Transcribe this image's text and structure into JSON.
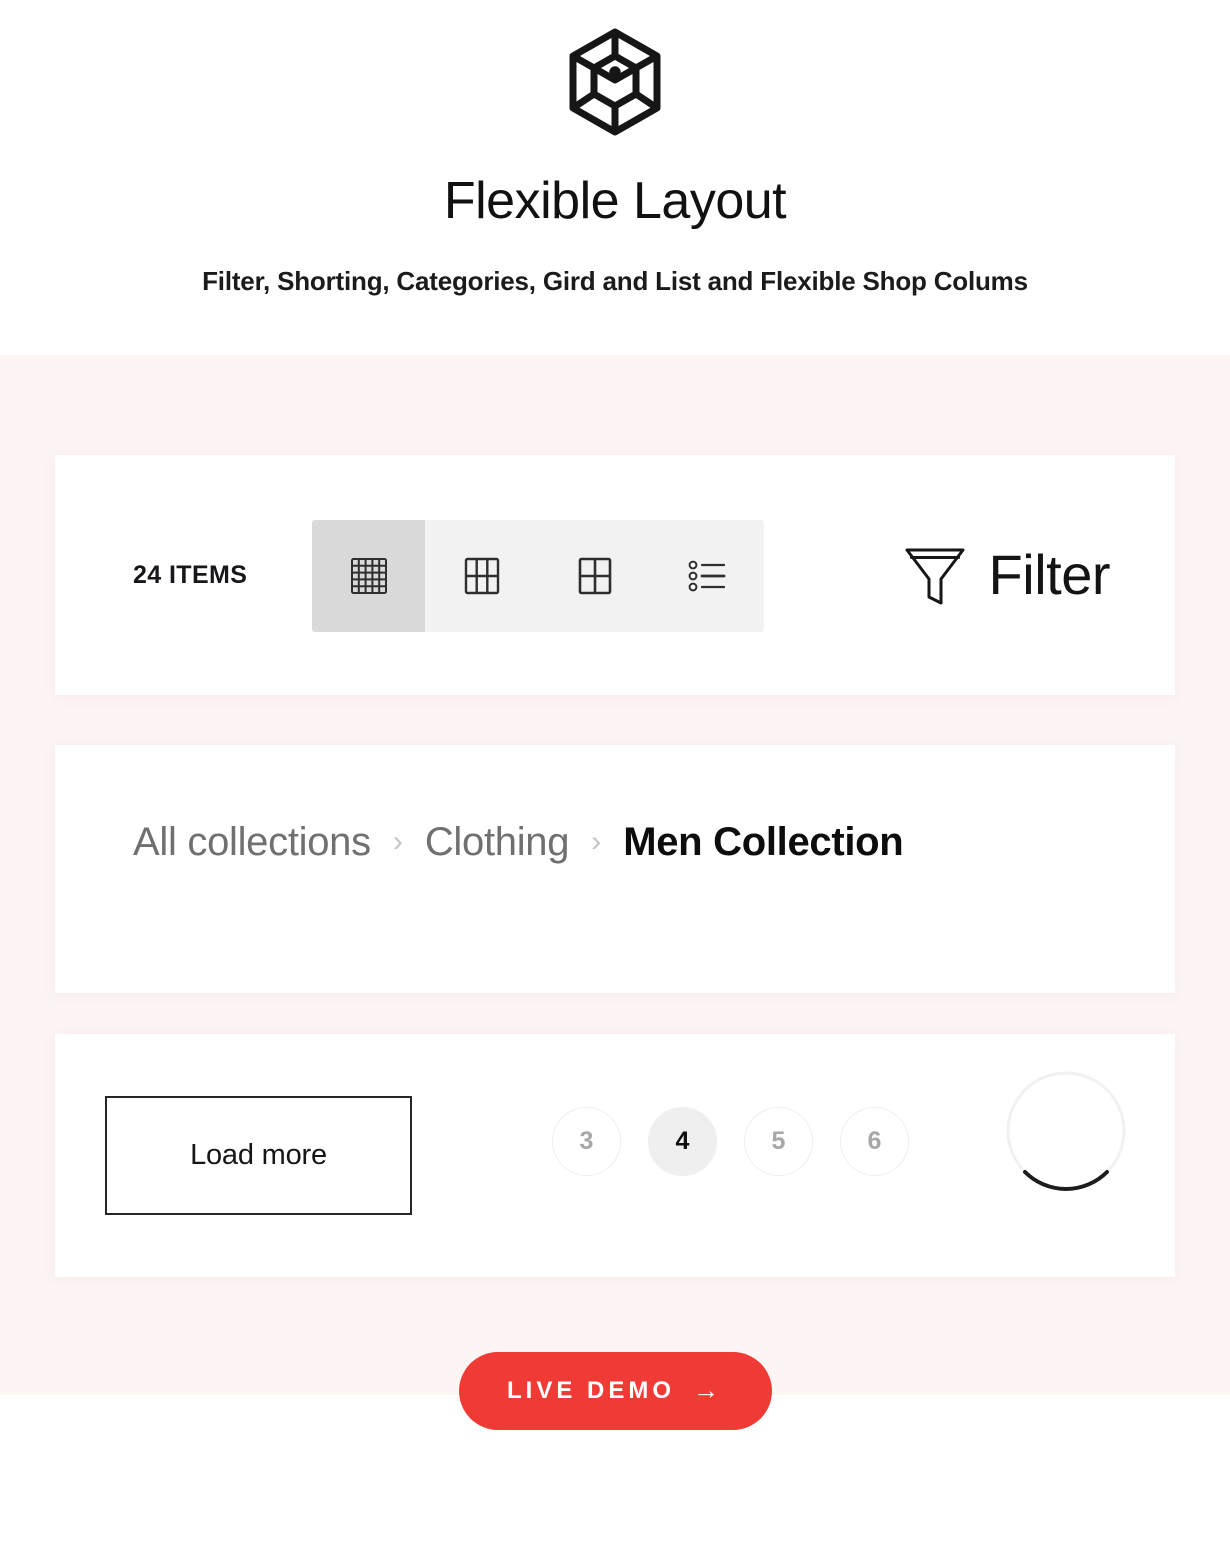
{
  "hero": {
    "logo_icon": "cube-logo-icon",
    "title": "Flexible Layout",
    "subtitle": "Filter, Shorting, Categories, Gird and List and Flexible Shop Colums"
  },
  "toolbar": {
    "items_count": "24 ITEMS",
    "view_modes": [
      {
        "name": "grid-5-col",
        "icon": "grid-dense-icon",
        "active": true
      },
      {
        "name": "grid-3-col",
        "icon": "grid-three-icon",
        "active": false
      },
      {
        "name": "grid-2-col",
        "icon": "grid-two-icon",
        "active": false
      },
      {
        "name": "list-view",
        "icon": "list-icon",
        "active": false
      }
    ],
    "filter_label": "Filter",
    "filter_icon": "funnel-icon"
  },
  "breadcrumb": {
    "separator": "›",
    "items": [
      {
        "label": "All collections",
        "current": false
      },
      {
        "label": "Clothing",
        "current": false
      },
      {
        "label": "Men Collection",
        "current": true
      }
    ]
  },
  "pagination": {
    "load_more_label": "Load more",
    "pages": [
      {
        "label": "3",
        "active": false
      },
      {
        "label": "4",
        "active": true
      },
      {
        "label": "5",
        "active": false
      },
      {
        "label": "6",
        "active": false
      }
    ],
    "spinner_icon": "loading-spinner-icon"
  },
  "cta": {
    "label": "LIVE DEMO",
    "arrow": "→"
  },
  "colors": {
    "band_background": "#fdf4f4",
    "card_background": "#ffffff",
    "accent_red": "#ef3a35",
    "toggle_track": "#f2f2f2",
    "toggle_active": "#d9d9d9",
    "page_active": "#efefef",
    "text_primary": "#111111",
    "text_muted": "#a7a7a7"
  }
}
